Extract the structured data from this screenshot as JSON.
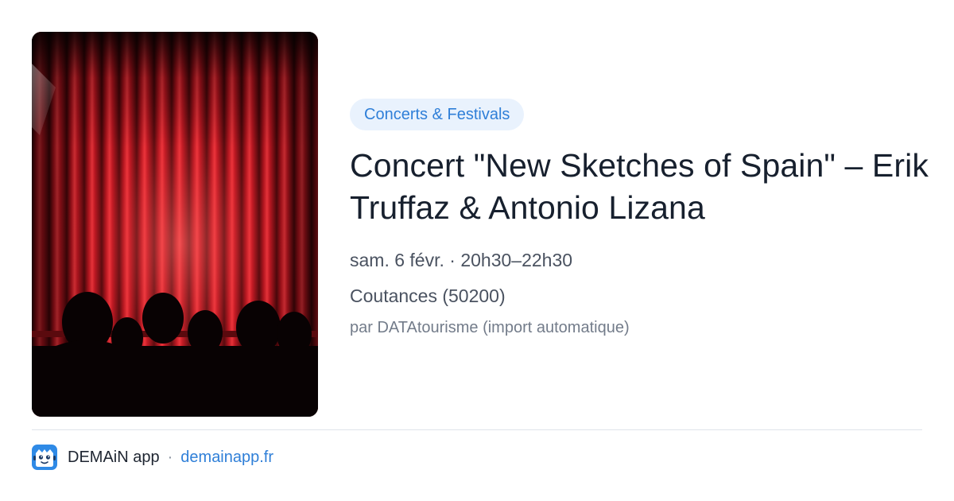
{
  "image": {
    "alt": "",
    "subject": "theatre-curtain-with-audience-silhouettes",
    "colors": {
      "curtain": "#a8101a",
      "curtain_highlight": "#ff5a55",
      "audience": "#080203"
    }
  },
  "event": {
    "category": "Concerts & Festivals",
    "title": "Concert \"New Sketches of Spain\" – Erik Truffaz & Antonio Lizana",
    "datetime": "sam. 6 févr. · 20h30–22h30",
    "location": "Coutances (50200)",
    "source": "par DATAtourisme (import automatique)"
  },
  "footer": {
    "logo_icon": "demain-app-logo-icon",
    "app_name": "DEMAiN app",
    "separator": "·",
    "domain": "demainapp.fr"
  },
  "colors": {
    "accent": "#2f7fd8",
    "pill_background": "#e9f2fd",
    "title": "#17202e",
    "text": "#4a5260",
    "muted": "#737c8a"
  }
}
